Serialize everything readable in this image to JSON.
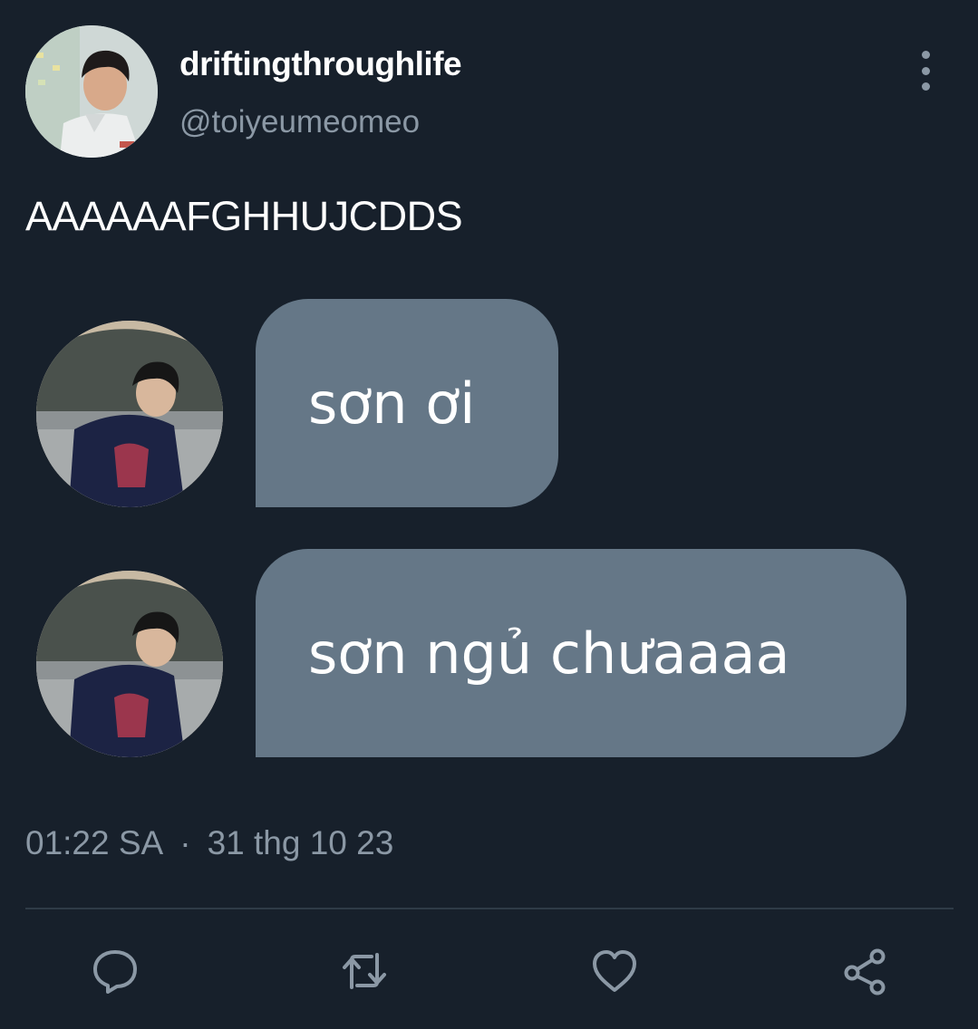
{
  "tweet": {
    "author": {
      "display_name": "driftingthroughlife",
      "handle": "@toiyeumeomeo"
    },
    "text": "AAAAAAFGHHUJCDDS",
    "media": {
      "messages": [
        {
          "text": "sơn ơi"
        },
        {
          "text": "sơn ngủ chưaaaa"
        }
      ]
    },
    "time": "01:22 SA",
    "separator": "·",
    "date": "31 thg 10 23"
  },
  "actions": {
    "icons": [
      "reply-icon",
      "retweet-icon",
      "like-icon",
      "share-icon"
    ]
  },
  "colors": {
    "background": "#17202b",
    "secondary_text": "#8b98a5",
    "bubble": "#657787",
    "divider": "#2f3b47"
  }
}
